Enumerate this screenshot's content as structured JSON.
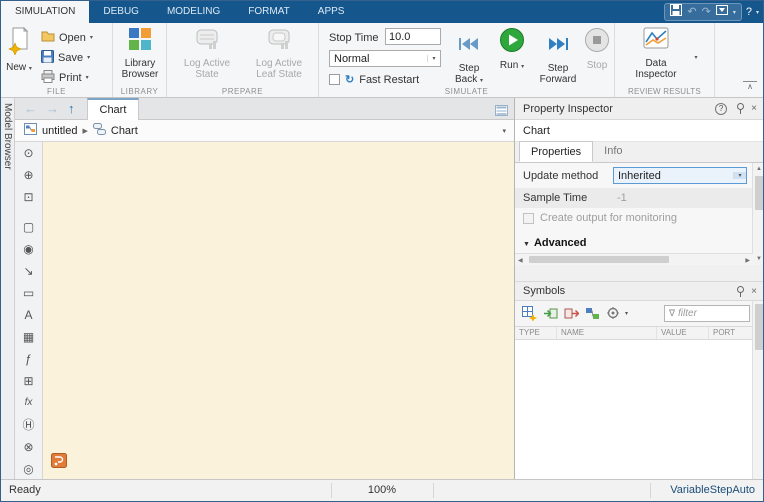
{
  "colors": {
    "toolstrip_blue": "#15568d",
    "canvas_cream": "#fbf2dc",
    "run_green": "#2ea83c",
    "accent_blue": "#2e74b5"
  },
  "topbar": {
    "tabs": [
      {
        "label": "SIMULATION",
        "active": true
      },
      {
        "label": "DEBUG",
        "active": false
      },
      {
        "label": "MODELING",
        "active": false
      },
      {
        "label": "FORMAT",
        "active": false
      },
      {
        "label": "APPS",
        "active": false
      }
    ]
  },
  "icons": {
    "undo": "↶",
    "redo": "↷",
    "help": "?",
    "dropdown": "▾",
    "nav_back": "←",
    "nav_forward": "→",
    "nav_up": "↑",
    "breadcrumb_separator": "▶",
    "advanced_caret": "▼",
    "filter_funnel": "∇",
    "close": "×",
    "scroll_up": "▲",
    "scroll_down": "▼",
    "scroll_left": "◀",
    "scroll_right": "▶",
    "collapse": "∧",
    "fast_restart": "↻"
  },
  "ribbon": {
    "file": {
      "section": "FILE",
      "new": "New",
      "open": "Open",
      "save": "Save",
      "print": "Print"
    },
    "library": {
      "section": "LIBRARY",
      "browser": "Library Browser"
    },
    "prepare": {
      "section": "PREPARE",
      "log_active_state": "Log Active State",
      "log_active_leaf_state": "Log Active Leaf State"
    },
    "simulate": {
      "section": "SIMULATE",
      "stop_time_label": "Stop Time",
      "stop_time_value": "10.0",
      "mode": "Normal",
      "fast_restart": "Fast Restart",
      "step_back": "Step Back",
      "run": "Run",
      "step_forward": "Step Forward",
      "stop": "Stop"
    },
    "review": {
      "section": "REVIEW RESULTS",
      "data_inspector": "Data Inspector"
    }
  },
  "editor": {
    "model_browser": "Model Browser",
    "document_tab": "Chart",
    "breadcrumb": {
      "model": "untitled",
      "chart": "Chart"
    },
    "palette": [
      {
        "name": "explore-icon",
        "glyph": "⊙"
      },
      {
        "name": "zoom-in-icon",
        "glyph": "⊕"
      },
      {
        "name": "fit-to-view-icon",
        "glyph": "⊡"
      },
      {
        "name": "state-icon",
        "glyph": "▢"
      },
      {
        "name": "junction-icon",
        "glyph": "◉"
      },
      {
        "name": "default-transition-icon",
        "glyph": "↘"
      },
      {
        "name": "box-icon",
        "glyph": "▭"
      },
      {
        "name": "annotation-icon",
        "glyph": "A"
      },
      {
        "name": "image-icon",
        "glyph": "▦"
      },
      {
        "name": "function-icon",
        "glyph": "ƒ"
      },
      {
        "name": "truth-table-icon",
        "glyph": "⊞"
      },
      {
        "name": "matlab-function-icon",
        "glyph": "fx"
      },
      {
        "name": "history-junction-icon",
        "glyph": "Ⓗ"
      },
      {
        "name": "junction-x-icon",
        "glyph": "⊗"
      },
      {
        "name": "entry-junction-icon",
        "glyph": "◎"
      }
    ]
  },
  "inspector": {
    "title": "Property Inspector",
    "object_name": "Chart",
    "tabs": {
      "properties": "Properties",
      "info": "Info"
    },
    "update_method_label": "Update method",
    "update_method_value": "Inherited",
    "sample_time_label": "Sample Time",
    "sample_time_value": "-1",
    "monitor_label": "Create output for monitoring",
    "advanced_label": "Advanced"
  },
  "symbols": {
    "title": "Symbols",
    "filter_placeholder": "filter",
    "columns": [
      "TYPE",
      "NAME",
      "VALUE",
      "PORT"
    ]
  },
  "statusbar": {
    "ready": "Ready",
    "zoom": "100%",
    "solver": "VariableStepAuto"
  }
}
